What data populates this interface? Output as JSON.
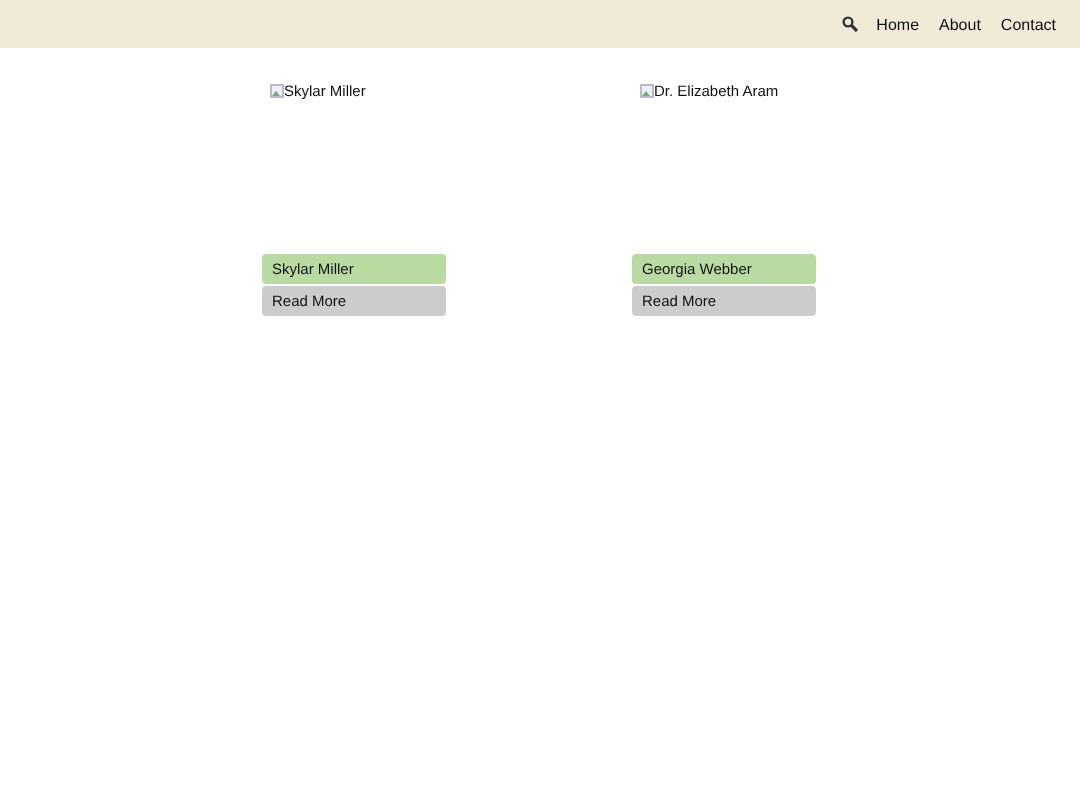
{
  "nav": {
    "links": [
      "Home",
      "About",
      "Contact"
    ]
  },
  "cards": [
    {
      "image_alt": "Skylar Miller",
      "name": "Skylar Miller",
      "button": "Read More"
    },
    {
      "image_alt": "Dr. Elizabeth Aram",
      "name": "Georgia Webber",
      "button": "Read More"
    }
  ]
}
